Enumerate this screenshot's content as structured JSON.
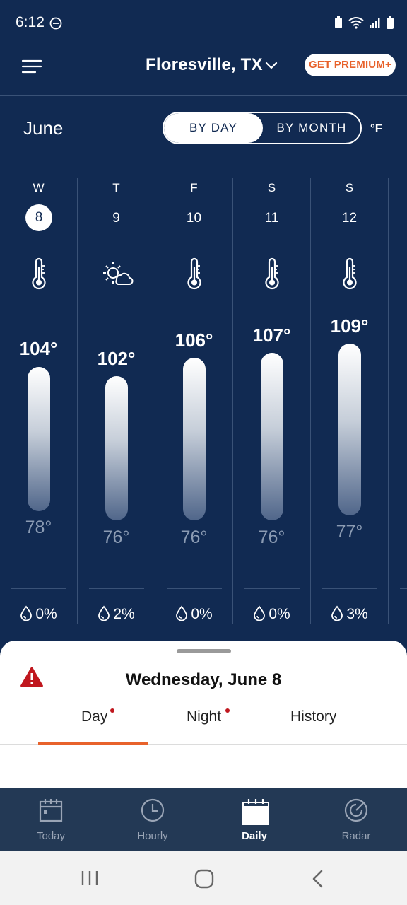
{
  "status_bar": {
    "time": "6:12"
  },
  "header": {
    "location": "Floresville, TX",
    "premium_label": "GET PREMIUM+"
  },
  "controls": {
    "month": "June",
    "by_day": "BY DAY",
    "by_month": "BY MONTH",
    "unit": "°F"
  },
  "days": [
    {
      "dow": "W",
      "date": "8",
      "icon": "thermometer-icon",
      "high": "104°",
      "low": "78°",
      "precip": "0%",
      "selected": true
    },
    {
      "dow": "T",
      "date": "9",
      "icon": "partly-cloudy-sun-icon",
      "high": "102°",
      "low": "76°",
      "precip": "2%"
    },
    {
      "dow": "F",
      "date": "10",
      "icon": "thermometer-icon",
      "high": "106°",
      "low": "76°",
      "precip": "0%"
    },
    {
      "dow": "S",
      "date": "11",
      "icon": "thermometer-icon",
      "high": "107°",
      "low": "76°",
      "precip": "0%"
    },
    {
      "dow": "S",
      "date": "12",
      "icon": "thermometer-icon",
      "high": "109°",
      "low": "77°",
      "precip": "3%"
    }
  ],
  "sheet": {
    "title": "Wednesday, June 8",
    "tabs": [
      {
        "label": "Day"
      },
      {
        "label": "Night"
      },
      {
        "label": "History"
      }
    ]
  },
  "nav": {
    "items": [
      {
        "label": "Today"
      },
      {
        "label": "Hourly"
      },
      {
        "label": "Daily"
      },
      {
        "label": "Radar"
      }
    ]
  },
  "colors": {
    "background": "#112a52",
    "accent": "#e8622b",
    "alert": "#c0171e"
  }
}
